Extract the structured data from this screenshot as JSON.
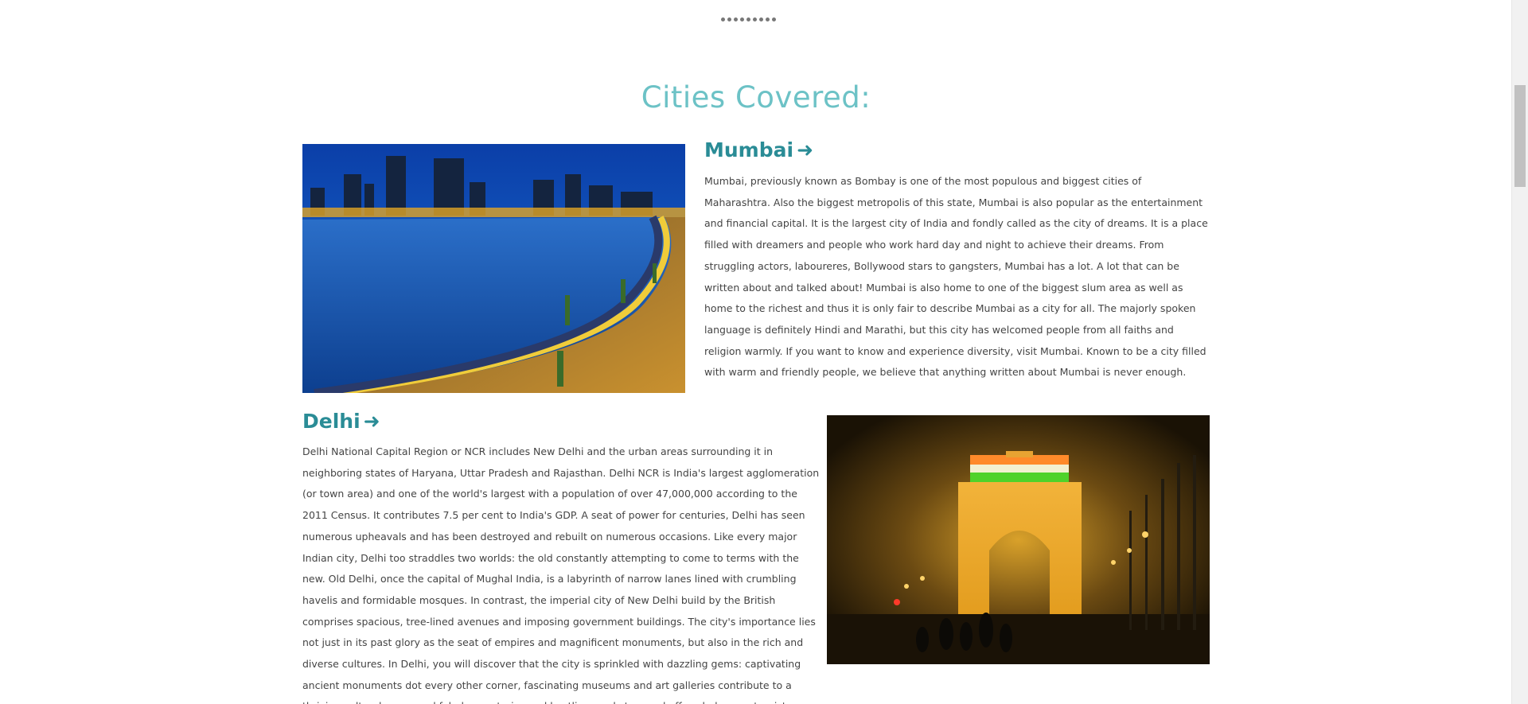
{
  "section": {
    "title": "Cities Covered:"
  },
  "carousel": {
    "dot_count": 9
  },
  "cities": [
    {
      "name": "Mumbai",
      "arrow": "➜",
      "image_alt": "Mumbai Marine Drive at night",
      "description": "Mumbai, previously known as Bombay is one of the most populous and biggest cities of Maharashtra. Also the biggest metropolis of this state, Mumbai is also popular as the entertainment and financial capital. It is the largest city of India and fondly called as the city of dreams. It is a place filled with dreamers and people who work hard day and night to achieve their dreams. From struggling actors, laboureres, Bollywood stars to gangsters, Mumbai has a lot. A lot that can be written about and talked about! Mumbai is also home to one of the biggest slum area as well as home to the richest and thus it is only fair to describe Mumbai as a city for all. The majorly spoken language is definitely Hindi and Marathi, but this city has welcomed people from all faiths and religion warmly. If you want to know and experience diversity, visit Mumbai. Known to be a city filled with warm and friendly people, we believe that anything written about Mumbai is never enough."
    },
    {
      "name": "Delhi",
      "arrow": "➜",
      "image_alt": "India Gate illuminated at night",
      "description": "Delhi National Capital Region or NCR includes New Delhi and the urban areas surrounding it in neighboring states of Haryana, Uttar Pradesh and Rajasthan. Delhi NCR is India's largest agglomeration (or town area) and one of the world's largest with a population of over 47,000,000 according to the 2011 Census. It contributes 7.5 per cent to India's GDP. A seat of power for centuries, Delhi has seen numerous upheavals and has been destroyed and rebuilt on numerous occasions. Like every major Indian city, Delhi too straddles two worlds: the old constantly attempting to come to terms with the new. Old Delhi, once the capital of Mughal India, is a labyrinth of narrow lanes lined with crumbling havelis and formidable mosques. In contrast, the imperial city of New Delhi build by the British comprises spacious, tree-lined avenues and imposing government buildings. The city's importance lies not just in its past glory as the seat of empires and magnificent monuments, but also in the rich and diverse cultures. In Delhi, you will discover that the city is sprinkled with dazzling gems: captivating ancient monuments dot every other corner, fascinating museums and art galleries contribute to a thriving cultural scene and fabulous eateries and bustling markets round off a wholesome tourist experience."
    }
  ],
  "colors": {
    "title": "#6cc2c6",
    "city_name": "#2a8c96",
    "body_text": "#444444"
  }
}
